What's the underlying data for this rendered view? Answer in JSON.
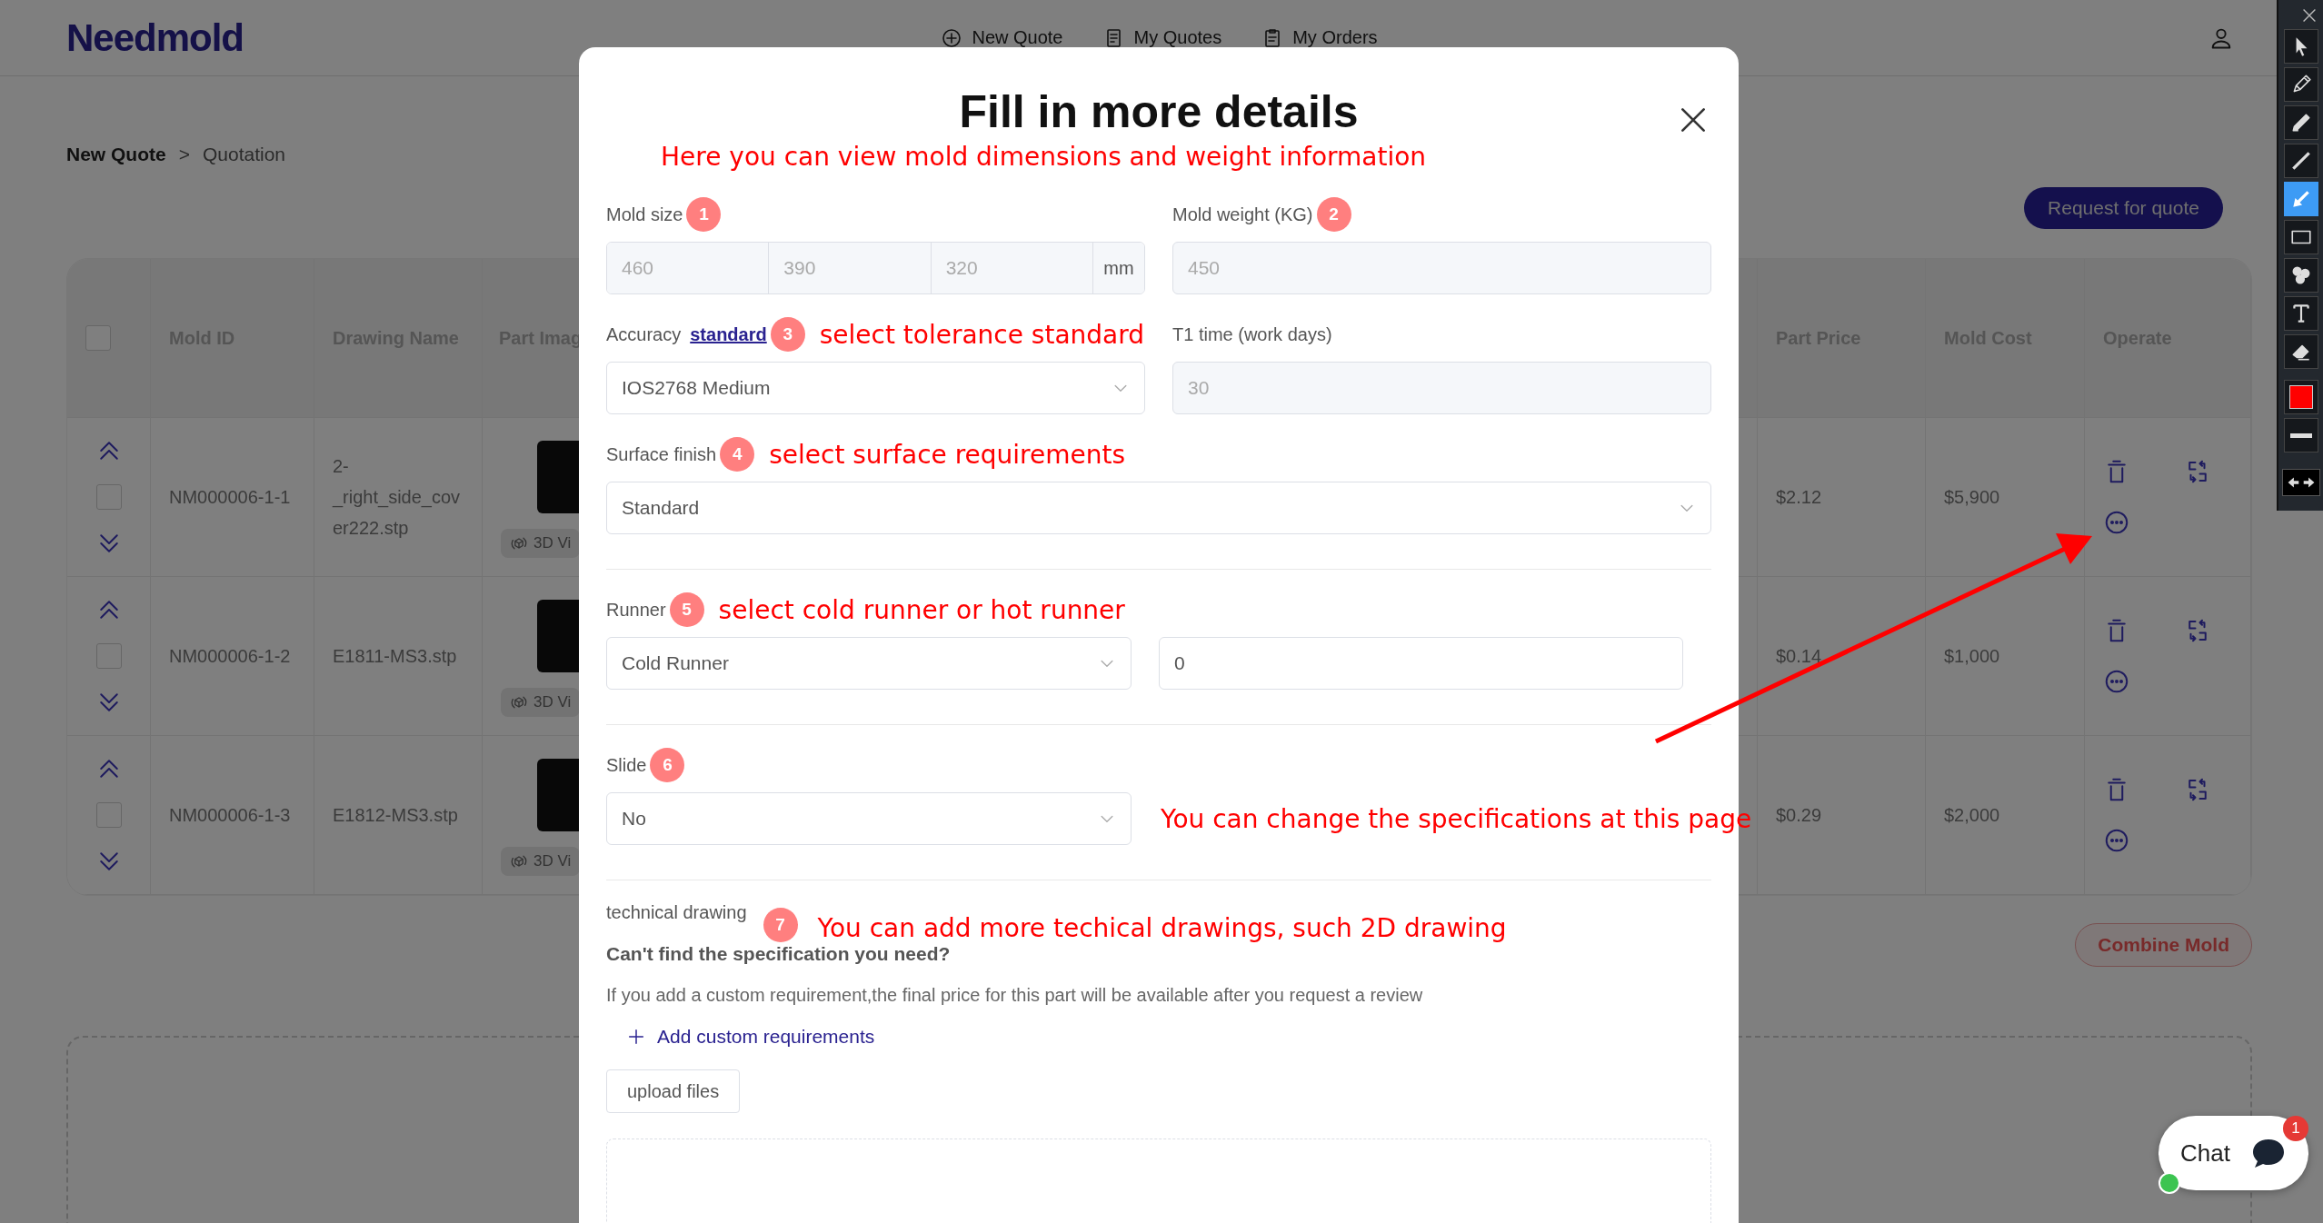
{
  "header": {
    "logo": "Needmold",
    "nav": [
      {
        "kind": "new",
        "label": "New Quote"
      },
      {
        "kind": "quotes",
        "label": "My Quotes"
      },
      {
        "kind": "orders",
        "label": "My Orders"
      }
    ]
  },
  "breadcrumb": {
    "items": [
      "New Quote",
      "Quotation"
    ],
    "separator": ">"
  },
  "request_button": "Request for quote",
  "table": {
    "header_checked": false,
    "columns": [
      "Mold ID",
      "Drawing Name",
      "Part Imag",
      "Part Price",
      "Mold Cost",
      "Operate"
    ],
    "rows": [
      {
        "checked": false,
        "mold_id": "NM000006-1-1",
        "drawing_name": "2-_right_side_cover222.stp",
        "view_3d": "3D Vi",
        "part_price": "$2.12",
        "mold_cost": "$5,900"
      },
      {
        "checked": false,
        "mold_id": "NM000006-1-2",
        "drawing_name": "E1811-MS3.stp",
        "view_3d": "3D Vi",
        "part_price": "$0.14",
        "mold_cost": "$1,000"
      },
      {
        "checked": false,
        "mold_id": "NM000006-1-3",
        "drawing_name": "E1812-MS3.stp",
        "view_3d": "3D Vi",
        "part_price": "$0.29",
        "mold_cost": "$2,000"
      }
    ]
  },
  "combine_button": "Combine Mold",
  "modal": {
    "title": "Fill in more details",
    "intro_note": "Here you can view mold dimensions and weight information",
    "mold_size": {
      "label": "Mold size",
      "badge": "1",
      "values": [
        "460",
        "390",
        "320"
      ],
      "unit": "mm",
      "disabled": true
    },
    "mold_weight": {
      "label": "Mold weight (KG)",
      "badge": "2",
      "value": "450",
      "disabled": true
    },
    "accuracy": {
      "label": "Accuracy",
      "link": "standard",
      "badge": "3",
      "note": "select tolerance standard",
      "value": "IOS2768 Medium"
    },
    "t1_time": {
      "label": "T1 time (work days)",
      "value": "30",
      "disabled": true
    },
    "surface_finish": {
      "label": "Surface finish",
      "badge": "4",
      "note": "select surface requirements",
      "value": "Standard"
    },
    "runner": {
      "label": "Runner",
      "badge": "5",
      "note": "select cold runner or hot runner",
      "value": "Cold Runner",
      "count": "0",
      "count_disabled": false
    },
    "slide": {
      "label": "Slide",
      "badge": "6",
      "value": "No",
      "side_note": "You can change the specifications at this page"
    },
    "technical_drawing": {
      "label": "technical drawing",
      "badge": "7",
      "note": "You can add more techical drawings, such 2D drawing",
      "heading": "Can't find the specification you need?",
      "hint": "If you add a custom requirement,the final price for this part will be available after you request a review",
      "add_link": "Add custom requirements",
      "upload_button": "upload files"
    }
  },
  "chat": {
    "label": "Chat",
    "badge": "1",
    "online": true
  },
  "toolbar": {
    "tools": [
      {
        "kind": "pointer",
        "selected": false
      },
      {
        "kind": "pencil",
        "selected": false
      },
      {
        "kind": "highlighter",
        "selected": false
      },
      {
        "kind": "line",
        "selected": false
      },
      {
        "kind": "arrow",
        "selected": true
      },
      {
        "kind": "rectangle",
        "selected": false
      },
      {
        "kind": "numbers",
        "selected": false
      },
      {
        "kind": "text",
        "selected": false
      },
      {
        "kind": "eraser",
        "selected": false
      }
    ]
  }
}
